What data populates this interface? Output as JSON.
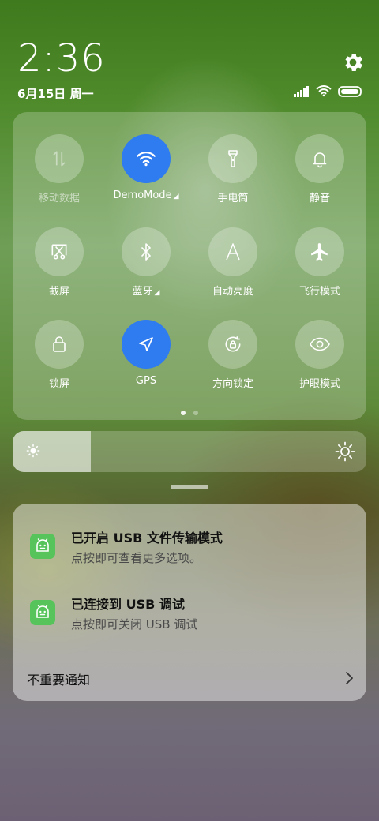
{
  "status": {
    "time": "2:36",
    "date": "6月15日 周一"
  },
  "icons": {
    "settings": "gear-icon",
    "signal": "signal-icon",
    "wifi": "wifi-icon",
    "battery": "battery-icon"
  },
  "quick_tiles": [
    {
      "label": "移动数据",
      "icon": "mobile-data-icon",
      "active": false,
      "disabled": true
    },
    {
      "label": "DemoMode",
      "icon": "wifi-icon",
      "active": true,
      "expandable": true
    },
    {
      "label": "手电筒",
      "icon": "flashlight-icon",
      "active": false
    },
    {
      "label": "静音",
      "icon": "bell-icon",
      "active": false
    },
    {
      "label": "截屏",
      "icon": "screenshot-icon",
      "active": false
    },
    {
      "label": "蓝牙",
      "icon": "bluetooth-icon",
      "active": false,
      "expandable": true
    },
    {
      "label": "自动亮度",
      "icon": "auto-brightness-icon",
      "active": false
    },
    {
      "label": "飞行模式",
      "icon": "airplane-icon",
      "active": false
    },
    {
      "label": "锁屏",
      "icon": "lock-icon",
      "active": false
    },
    {
      "label": "GPS",
      "icon": "location-arrow-icon",
      "active": true
    },
    {
      "label": "方向锁定",
      "icon": "rotation-lock-icon",
      "active": false
    },
    {
      "label": "护眼模式",
      "icon": "eye-icon",
      "active": false
    }
  ],
  "tile_expand_glyph": "◢",
  "pager": {
    "pages": 2,
    "current": 1
  },
  "brightness": {
    "level": 0.22
  },
  "notifications": [
    {
      "title": "已开启 USB 文件传输模式",
      "subtitle": "点按即可查看更多选项。",
      "icon": "android-icon"
    },
    {
      "title": "已连接到 USB 调试",
      "subtitle": "点按即可关闭 USB 调试",
      "icon": "android-icon"
    }
  ],
  "unimportant_label": "不重要通知",
  "colors": {
    "accent": "#2f7bf0",
    "app_icon": "#56c45a"
  }
}
